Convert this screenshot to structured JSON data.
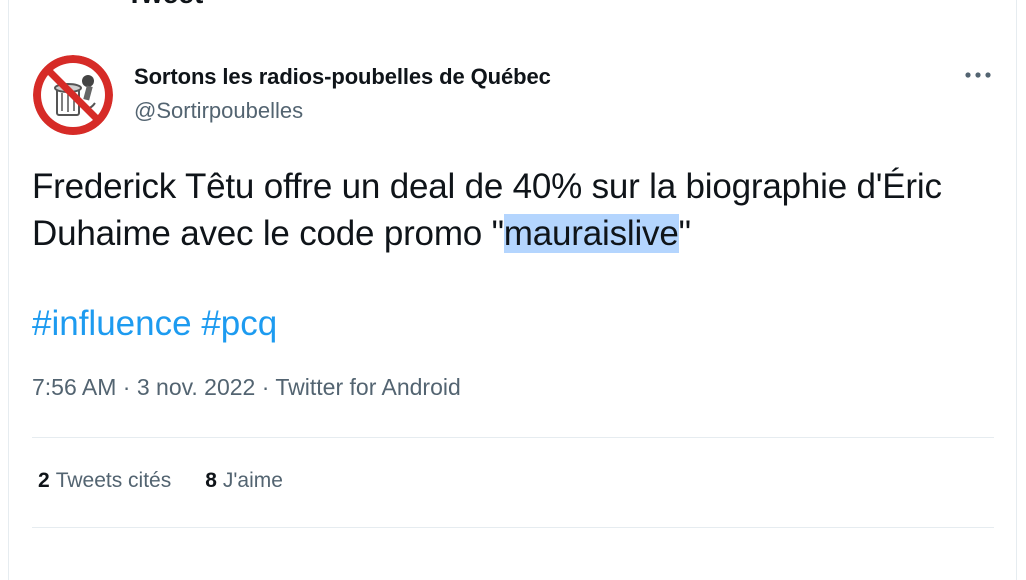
{
  "header_cut_text": "Tweet",
  "author": {
    "name": "Sortons les radios-poubelles de Québec",
    "handle": "@Sortirpoubelles"
  },
  "more_icon": "ellipsis-icon",
  "tweet": {
    "text_before": "Frederick Têtu offre un deal de 40% sur la biographie d'Éric Duhaime avec le code promo \"",
    "text_highlight": "mauraislive",
    "text_after": "\"",
    "hashtags": [
      "#influence",
      "#pcq"
    ],
    "time": "7:56 AM",
    "date": "3 nov. 2022",
    "source": "Twitter for Android",
    "separator": "·"
  },
  "stats": {
    "quotes_count": "2",
    "quotes_label": "Tweets cités",
    "likes_count": "8",
    "likes_label": "J'aime"
  },
  "colors": {
    "link": "#1d9bf0",
    "secondary_text": "#536471",
    "highlight": "#b4d5fe",
    "avatar_red": "#d62b27"
  }
}
